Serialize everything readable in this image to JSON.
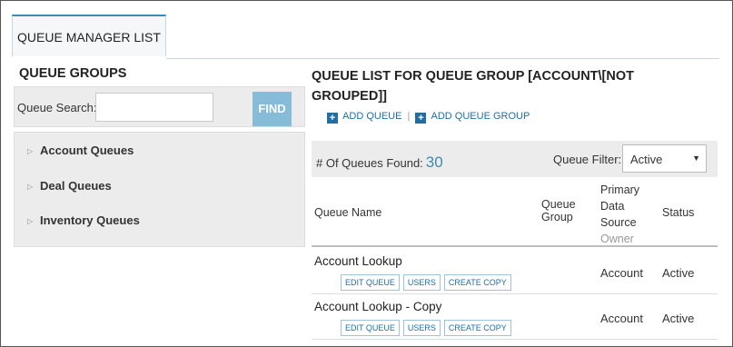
{
  "tab": {
    "label": "QUEUE MANAGER LIST"
  },
  "groups": {
    "title": "QUEUE GROUPS",
    "search_label": "Queue Search:",
    "search_value": "",
    "find_label": "FIND",
    "items": [
      {
        "label": "Account Queues"
      },
      {
        "label": "Deal Queues"
      },
      {
        "label": "Inventory Queues"
      }
    ]
  },
  "list": {
    "title": "QUEUE LIST FOR QUEUE GROUP [ACCOUNT\\[NOT GROUPED]]",
    "add_queue": "ADD QUEUE",
    "separator": "|",
    "add_queue_group": "ADD QUEUE GROUP",
    "found_label": "# Of Queues Found:",
    "found_count": "30",
    "filter_label": "Queue Filter:",
    "filter_value": "Active",
    "columns": {
      "name": "Queue Name",
      "group_line1": "Queue",
      "group_line2": "Group",
      "source_line1": "Primary",
      "source_line2": "Data",
      "source_line3": "Source",
      "source_sub": "Owner",
      "status": "Status"
    },
    "rows": [
      {
        "name": "Account Lookup",
        "edit": "EDIT QUEUE",
        "users": "USERS",
        "copy": "CREATE COPY",
        "source": "Account",
        "status": "Active"
      },
      {
        "name": "Account Lookup - Copy",
        "edit": "EDIT QUEUE",
        "users": "USERS",
        "copy": "CREATE COPY",
        "source": "Account",
        "status": "Active"
      }
    ]
  }
}
